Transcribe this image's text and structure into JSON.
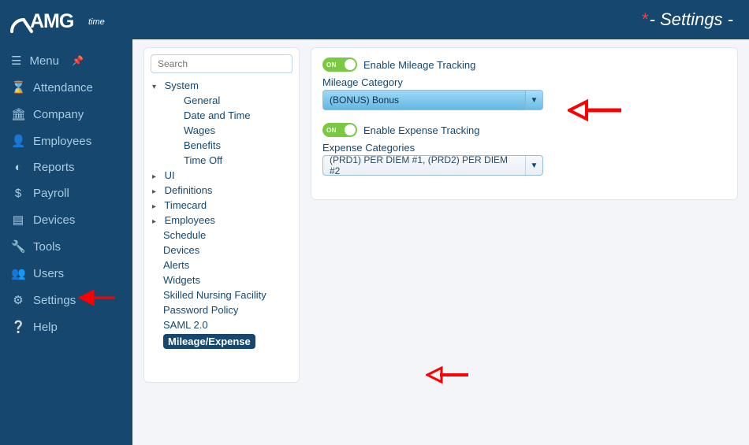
{
  "header": {
    "brand": "AMG time",
    "page_title": "- Settings -"
  },
  "sidebar": {
    "menu_label": "Menu",
    "items": [
      {
        "label": "Attendance",
        "icon": "hourglass"
      },
      {
        "label": "Company",
        "icon": "bank"
      },
      {
        "label": "Employees",
        "icon": "user"
      },
      {
        "label": "Reports",
        "icon": "piechart"
      },
      {
        "label": "Payroll",
        "icon": "dollar"
      },
      {
        "label": "Devices",
        "icon": "devices"
      },
      {
        "label": "Tools",
        "icon": "wrench"
      },
      {
        "label": "Users",
        "icon": "users"
      },
      {
        "label": "Settings",
        "icon": "gear"
      },
      {
        "label": "Help",
        "icon": "help"
      }
    ]
  },
  "tree": {
    "search_placeholder": "Search",
    "nodes": [
      {
        "label": "System",
        "expanded": true,
        "children": [
          {
            "label": "General"
          },
          {
            "label": "Date and Time"
          },
          {
            "label": "Wages"
          },
          {
            "label": "Benefits"
          },
          {
            "label": "Time Off"
          }
        ]
      },
      {
        "label": "UI",
        "expanded": false
      },
      {
        "label": "Definitions",
        "expanded": false
      },
      {
        "label": "Timecard",
        "expanded": false
      },
      {
        "label": "Employees",
        "expanded": false
      }
    ],
    "leaves": [
      "Schedule",
      "Devices",
      "Alerts",
      "Widgets",
      "Skilled Nursing Facility",
      "Password Policy",
      "SAML 2.0",
      "Mileage/Expense"
    ],
    "selected": "Mileage/Expense"
  },
  "settings": {
    "mileage": {
      "toggle_text": "ON",
      "toggle_label": "Enable Mileage Tracking",
      "field_label": "Mileage Category",
      "value": "(BONUS) Bonus"
    },
    "expense": {
      "toggle_text": "ON",
      "toggle_label": "Enable Expense Tracking",
      "field_label": "Expense Categories",
      "value": "(PRD1) PER DIEM #1, (PRD2) PER DIEM #2"
    }
  }
}
